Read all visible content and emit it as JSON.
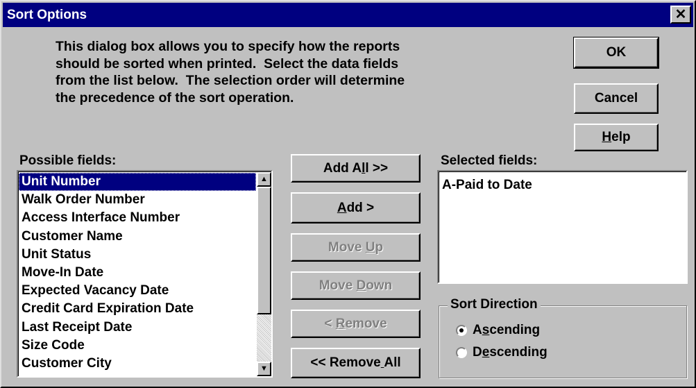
{
  "window": {
    "title": "Sort Options",
    "close_glyph": "✕"
  },
  "description": "This dialog box allows you to specify how the reports\nshould be sorted when printed.  Select the data fields\nfrom the list below.  The selection order will determine\nthe precedence of the sort operation.",
  "buttons": {
    "ok": "OK",
    "cancel": "Cancel",
    "help": "Help",
    "add_all": "Add All >>",
    "add": "Add >",
    "move_up": "Move Up",
    "move_down": "Move Down",
    "remove": "< Remove",
    "remove_all": "<< Remove All"
  },
  "possible_fields": {
    "label": "Possible fields:",
    "items": [
      "Unit Number",
      "Walk Order Number",
      "Access Interface Number",
      "Customer Name",
      "Unit Status",
      "Move-In Date",
      "Expected Vacancy Date",
      "Credit Card Expiration Date",
      "Last Receipt Date",
      "Size Code",
      "Customer City"
    ],
    "selected_index": 0
  },
  "selected_fields": {
    "label": "Selected fields:",
    "items": [
      "A-Paid to Date"
    ]
  },
  "sort_direction": {
    "label": "Sort Direction",
    "options": [
      "Ascending",
      "Descending"
    ],
    "selected": "Ascending"
  },
  "colors": {
    "titlebar": "#000080",
    "face": "#c0c0c0",
    "selection": "#000080"
  }
}
